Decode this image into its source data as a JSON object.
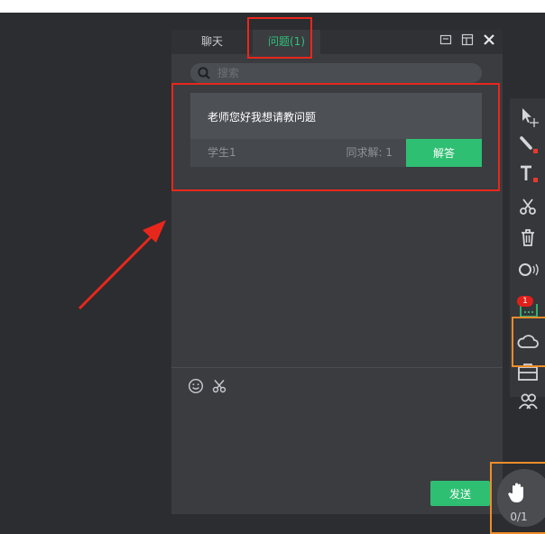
{
  "tabs": {
    "chat": "聊天",
    "questions": "问题(1)"
  },
  "search": {
    "placeholder": "搜索"
  },
  "question_card": {
    "text": "老师您好我想请教问题",
    "student": "学生1",
    "same_request": "同求解: 1",
    "answer_button": "解答"
  },
  "composer": {
    "send_button": "发送"
  },
  "toolbar": {
    "tools": [
      "pointer-move-icon",
      "pen-icon",
      "text-icon",
      "scissors-icon",
      "trash-icon",
      "record-icon",
      "checkin-icon",
      "cloud-icon",
      "toolbox-icon",
      "group-icon"
    ],
    "badge_count": "1"
  },
  "hand_raise": {
    "count": "0/1"
  },
  "colors": {
    "accent": "#2fbf72",
    "annotation_red": "#e8271c",
    "annotation_orange": "#f08c2a"
  }
}
